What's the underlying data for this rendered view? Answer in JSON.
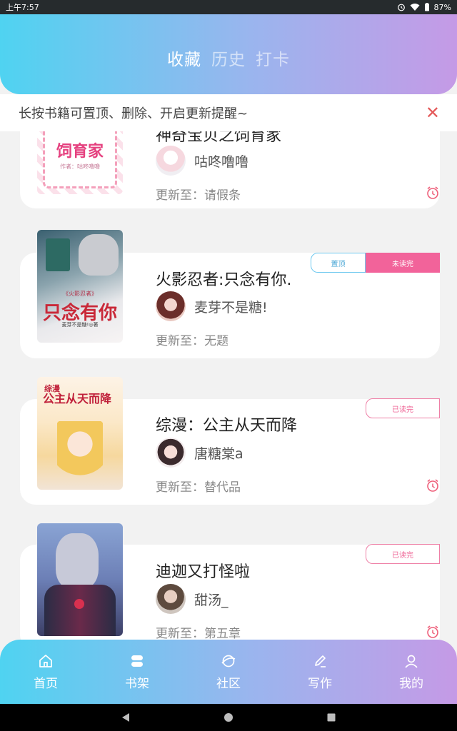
{
  "status_bar": {
    "time": "上午7:57",
    "battery": "87%"
  },
  "header": {
    "tabs": [
      "收藏",
      "历史",
      "打卡"
    ],
    "active_tab": "收藏"
  },
  "tip": {
    "text": "长按书籍可置顶、删除、开启更新提醒~",
    "close_icon": "close-icon"
  },
  "books": [
    {
      "title": "神奇宝贝之饲育家",
      "cover_text": "饲育家",
      "cover_subtext": "作者：咕咚噜噜",
      "author": "咕咚噜噜",
      "update_label": "更新至：",
      "update_value": "请假条",
      "badges": []
    },
    {
      "title": "火影忍者:只念有你.",
      "cover_text": "只念有你",
      "cover_subtext": "《火影忍者》",
      "cover_author": "麦芽不是糖!◎著",
      "author": "麦芽不是糖!",
      "update_label": "更新至：",
      "update_value": "无题",
      "badges": [
        "置顶",
        "未读完"
      ]
    },
    {
      "title": "综漫：公主从天而降",
      "cover_text": "公主从天而降",
      "cover_prefix": "综漫",
      "author": "唐糖棠a",
      "update_label": "更新至：",
      "update_value": "替代品",
      "badges": [
        "已读完"
      ]
    },
    {
      "title": "迪迦又打怪啦",
      "author": "甜汤_",
      "update_label": "更新至：",
      "update_value": "第五章",
      "badges": [
        "已读完"
      ]
    }
  ],
  "bottom_nav": [
    {
      "label": "首页",
      "icon": "home-icon"
    },
    {
      "label": "书架",
      "icon": "bookshelf-icon"
    },
    {
      "label": "社区",
      "icon": "community-icon"
    },
    {
      "label": "写作",
      "icon": "pen-icon"
    },
    {
      "label": "我的",
      "icon": "user-icon"
    }
  ],
  "colors": {
    "gradient_start": "#4fd3f1",
    "gradient_end": "#c59ae6",
    "accent_pink": "#f2639a",
    "accent_blue": "#4aa7d6",
    "close_red": "#e45a5a"
  }
}
